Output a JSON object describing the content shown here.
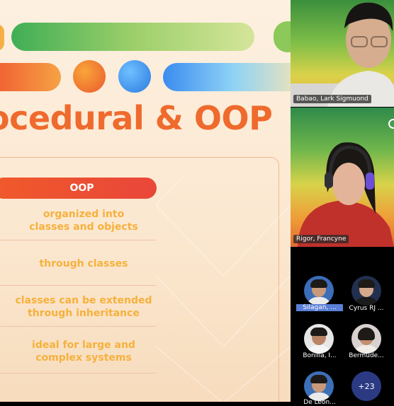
{
  "slide": {
    "title": "ocedural & OOP",
    "column_header": "OOP",
    "rows": [
      "organized into\nclasses and  objects",
      "through classes",
      "classes can be extended\nthrough inheritance",
      "ideal for large and\ncomplex systems"
    ]
  },
  "video": {
    "speakers": [
      {
        "name": "Babao, Lark Sigmuond"
      },
      {
        "name": "Rigor, Francyne"
      }
    ],
    "participants": [
      {
        "name": "Silagan, ..."
      },
      {
        "name": "Cyrus RJ ..."
      },
      {
        "name": "Bonilla, I..."
      },
      {
        "name": "Bermude..."
      },
      {
        "name": "De Leon..."
      }
    ],
    "overflow_count": "+23"
  },
  "colors": {
    "accent_orange": "#ef6a2d",
    "row_text": "#f6b13c",
    "header_red": "#e9463a"
  }
}
